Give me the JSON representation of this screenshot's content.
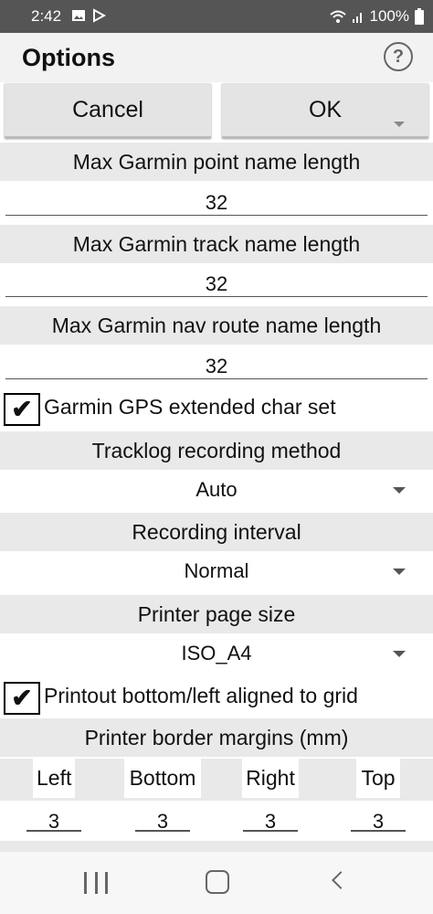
{
  "status_bar": {
    "time": "2:42",
    "battery": "100%"
  },
  "title_bar": {
    "title": "Options",
    "help_icon": "?"
  },
  "buttons": {
    "cancel": "Cancel",
    "ok": "OK"
  },
  "settings": {
    "max_point_name": {
      "label": "Max Garmin point name length",
      "value": "32"
    },
    "max_track_name": {
      "label": "Max Garmin track name length",
      "value": "32"
    },
    "max_route_name": {
      "label": "Max Garmin nav route name length",
      "value": "32"
    },
    "extended_charset": {
      "label": "Garmin GPS extended char set",
      "checked": true,
      "mark": "✔"
    },
    "tracklog_method": {
      "label": "Tracklog recording method",
      "value": "Auto"
    },
    "recording_interval": {
      "label": "Recording interval",
      "value": "Normal"
    },
    "page_size": {
      "label": "Printer page size",
      "value": "ISO_A4"
    },
    "printout_aligned": {
      "label": "Printout bottom/left aligned to grid",
      "checked": true,
      "mark": "✔"
    },
    "border_margins": {
      "label": "Printer border margins (mm)",
      "left": {
        "label": "Left",
        "value": "3"
      },
      "bottom": {
        "label": "Bottom",
        "value": "3"
      },
      "right": {
        "label": "Right",
        "value": "3"
      },
      "top": {
        "label": "Top",
        "value": "3"
      }
    }
  },
  "icons": [
    "image-icon",
    "play-store-icon",
    "wifi-icon",
    "signal-icon",
    "battery-icon",
    "help-icon",
    "dropdown-arrow-icon",
    "recent-apps-icon",
    "home-icon",
    "back-icon"
  ]
}
